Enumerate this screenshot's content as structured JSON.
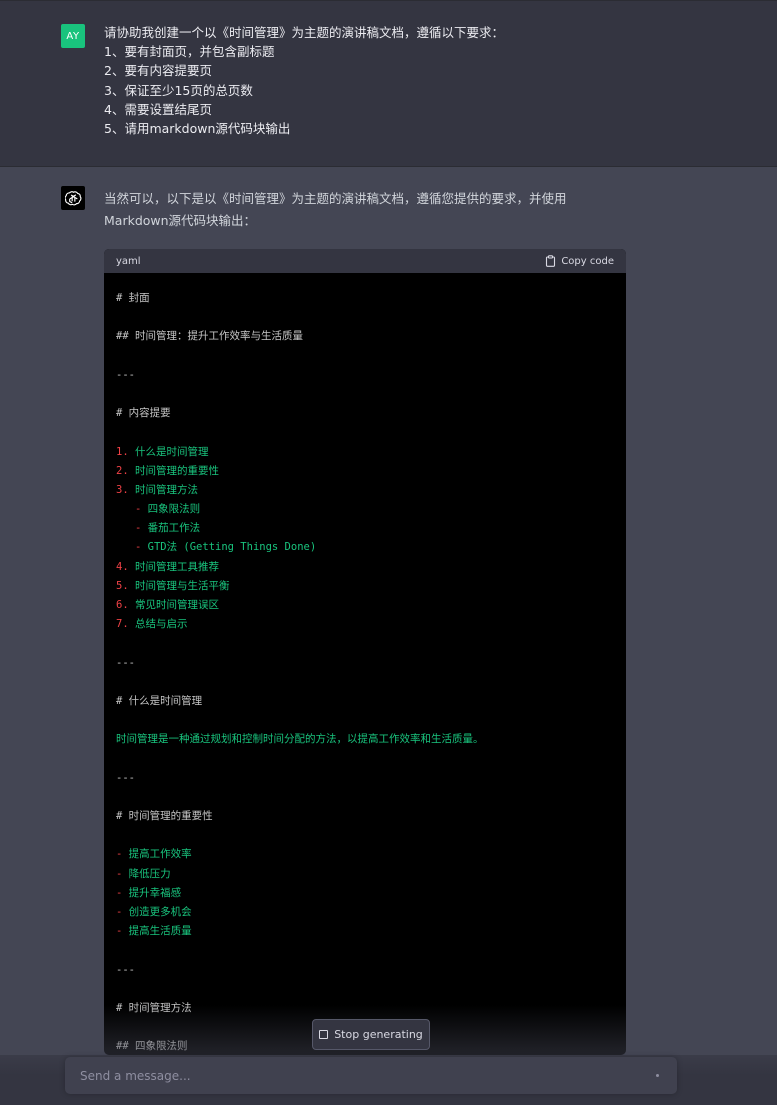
{
  "user": {
    "avatar_initials": "AY",
    "lines": [
      "请协助我创建一个以《时间管理》为主题的演讲稿文档，遵循以下要求：",
      "1、要有封面页，并包含副标题",
      "2、要有内容提要页",
      "3、保证至少15页的总页数",
      "4、需要设置结尾页",
      "5、请用markdown源代码块输出"
    ]
  },
  "assistant": {
    "intro": "当然可以，以下是以《时间管理》为主题的演讲稿文档，遵循您提供的要求，并使用Markdown源代码块输出："
  },
  "code_block": {
    "language": "yaml",
    "copy_label": "Copy code",
    "lines": [
      {
        "text": "# 封面",
        "color": "grey"
      },
      {
        "text": "",
        "color": "grey"
      },
      {
        "text": "## 时间管理：提升工作效率与生活质量",
        "color": "grey"
      },
      {
        "text": "",
        "color": "grey"
      },
      {
        "text": "---",
        "color": "grey"
      },
      {
        "text": "",
        "color": "grey"
      },
      {
        "text": "# 内容提要",
        "color": "grey"
      },
      {
        "text": "",
        "color": "grey"
      },
      {
        "prefix": "1.",
        "text": " 什么是时间管理",
        "color": "list"
      },
      {
        "prefix": "2.",
        "text": " 时间管理的重要性",
        "color": "list"
      },
      {
        "prefix": "3.",
        "text": " 时间管理方法",
        "color": "list"
      },
      {
        "prefix": "   -",
        "text": " 四象限法则",
        "color": "list"
      },
      {
        "prefix": "   -",
        "text": " 番茄工作法",
        "color": "list"
      },
      {
        "prefix": "   -",
        "text": " GTD法 (Getting Things Done)",
        "color": "list"
      },
      {
        "prefix": "4.",
        "text": " 时间管理工具推荐",
        "color": "list"
      },
      {
        "prefix": "5.",
        "text": " 时间管理与生活平衡",
        "color": "list"
      },
      {
        "prefix": "6.",
        "text": " 常见时间管理误区",
        "color": "list"
      },
      {
        "prefix": "7.",
        "text": " 总结与启示",
        "color": "list"
      },
      {
        "text": "",
        "color": "grey"
      },
      {
        "text": "---",
        "color": "grey"
      },
      {
        "text": "",
        "color": "grey"
      },
      {
        "text": "# 什么是时间管理",
        "color": "grey"
      },
      {
        "text": "",
        "color": "grey"
      },
      {
        "text": "时间管理是一种通过规划和控制时间分配的方法，以提高工作效率和生活质量。",
        "color": "green"
      },
      {
        "text": "",
        "color": "grey"
      },
      {
        "text": "---",
        "color": "grey"
      },
      {
        "text": "",
        "color": "grey"
      },
      {
        "text": "# 时间管理的重要性",
        "color": "grey"
      },
      {
        "text": "",
        "color": "grey"
      },
      {
        "prefix": "-",
        "text": " 提高工作效率",
        "color": "list"
      },
      {
        "prefix": "-",
        "text": " 降低压力",
        "color": "list"
      },
      {
        "prefix": "-",
        "text": " 提升幸福感",
        "color": "list"
      },
      {
        "prefix": "-",
        "text": " 创造更多机会",
        "color": "list"
      },
      {
        "prefix": "-",
        "text": " 提高生活质量",
        "color": "list"
      },
      {
        "text": "",
        "color": "grey"
      },
      {
        "text": "---",
        "color": "grey"
      },
      {
        "text": "",
        "color": "grey"
      },
      {
        "text": "# 时间管理方法",
        "color": "grey"
      },
      {
        "text": "",
        "color": "grey"
      },
      {
        "text": "## 四象限法则",
        "color": "grey"
      }
    ]
  },
  "stop_button": {
    "label": "Stop generating",
    "icon": "stop-icon"
  },
  "composer": {
    "placeholder": "Send a message..."
  },
  "colors": {
    "user_bg": "#343541",
    "assistant_bg": "#444654",
    "accent_green": "#19c37d",
    "code_red": "#ef4146"
  }
}
